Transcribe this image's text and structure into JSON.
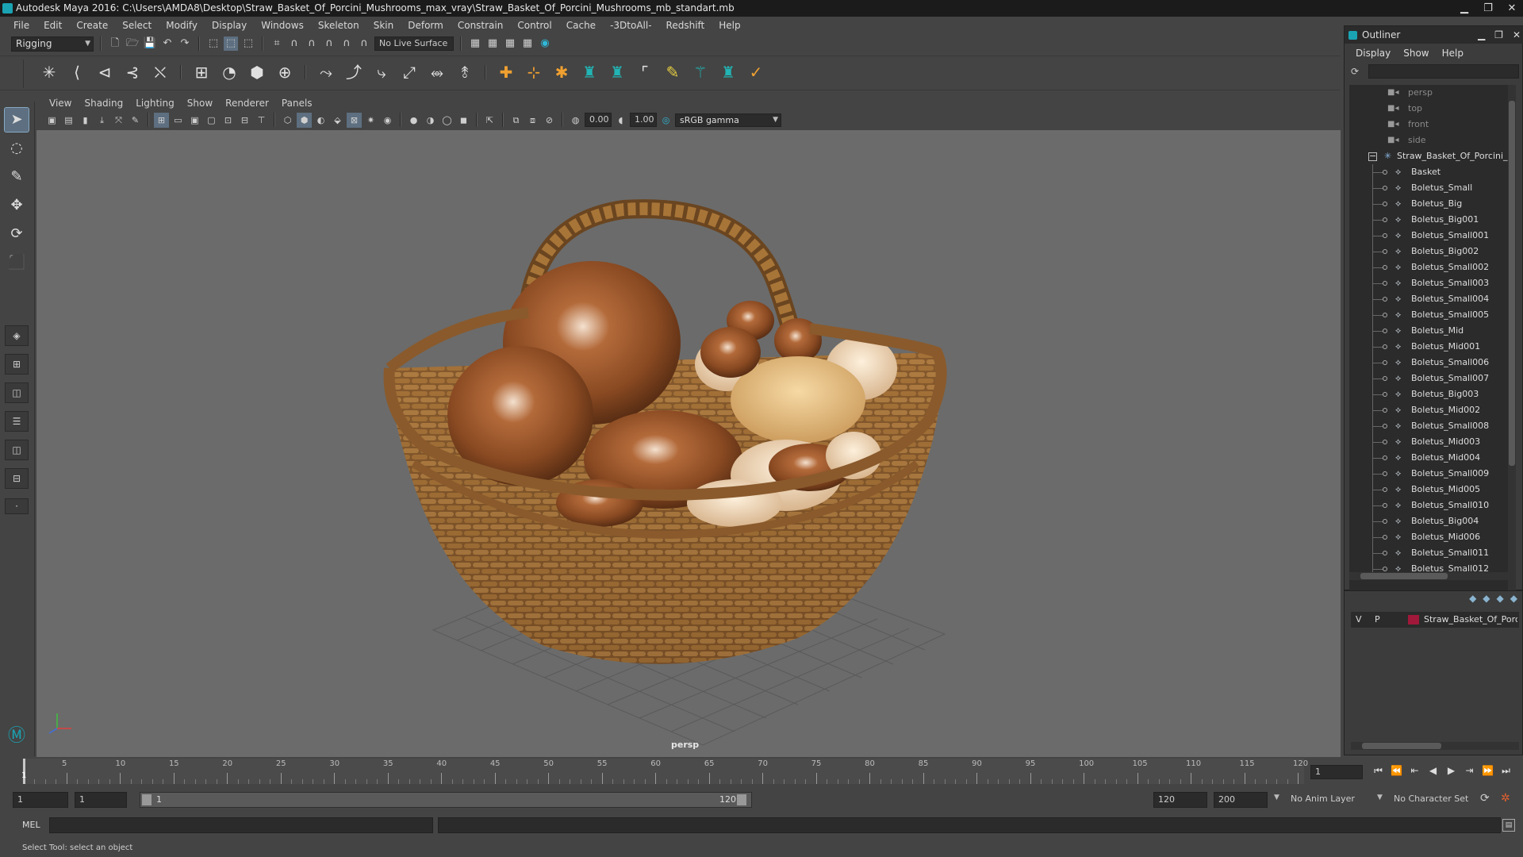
{
  "window": {
    "title": "Autodesk Maya 2016: C:\\Users\\AMDA8\\Desktop\\Straw_Basket_Of_Porcini_Mushrooms_max_vray\\Straw_Basket_Of_Porcini_Mushrooms_mb_standart.mb",
    "minimize": "▁",
    "restore": "❐",
    "close": "✕"
  },
  "menubar": [
    "File",
    "Edit",
    "Create",
    "Select",
    "Modify",
    "Display",
    "Windows",
    "Skeleton",
    "Skin",
    "Deform",
    "Constrain",
    "Control",
    "Cache",
    "-3DtoAll-",
    "Redshift",
    "Help"
  ],
  "statusline": {
    "mode": "Rigging",
    "live_surface": "No Live Surface"
  },
  "panel": {
    "menu": [
      "View",
      "Shading",
      "Lighting",
      "Show",
      "Renderer",
      "Panels"
    ],
    "near": "0.00",
    "far": "1.00",
    "colorspace": "sRGB gamma",
    "camera_label": "persp"
  },
  "outliner": {
    "title": "Outliner",
    "menu": [
      "Display",
      "Show",
      "Help"
    ],
    "cameras": [
      "persp",
      "top",
      "front",
      "side"
    ],
    "group": "Straw_Basket_Of_Porcini_Mushrooms",
    "items": [
      "Basket",
      "Boletus_Small",
      "Boletus_Big",
      "Boletus_Big001",
      "Boletus_Small001",
      "Boletus_Big002",
      "Boletus_Small002",
      "Boletus_Small003",
      "Boletus_Small004",
      "Boletus_Small005",
      "Boletus_Mid",
      "Boletus_Mid001",
      "Boletus_Small006",
      "Boletus_Small007",
      "Boletus_Big003",
      "Boletus_Mid002",
      "Boletus_Small008",
      "Boletus_Mid003",
      "Boletus_Mid004",
      "Boletus_Small009",
      "Boletus_Mid005",
      "Boletus_Small010",
      "Boletus_Big004",
      "Boletus_Mid006",
      "Boletus_Small011",
      "Boletus_Small012"
    ]
  },
  "layers": {
    "visible": "V",
    "playback": "P",
    "name": "Straw_Basket_Of_Porcini_Mushrooms",
    "color": "#a0183a"
  },
  "timeline": {
    "labels": [
      "1",
      "5",
      "10",
      "15",
      "20",
      "25",
      "30",
      "35",
      "40",
      "45",
      "50",
      "55",
      "60",
      "65",
      "70",
      "75",
      "80",
      "85",
      "90",
      "95",
      "100",
      "105",
      "110",
      "115",
      "120"
    ],
    "current_frame": "1"
  },
  "range": {
    "start": "1",
    "playback_start": "1",
    "slider_start": "1",
    "slider_end": "120",
    "playback_end": "120",
    "end": "200",
    "anim_layer": "No Anim Layer",
    "character_set": "No Character Set"
  },
  "command": {
    "lang": "MEL"
  },
  "help": {
    "text": "Select Tool: select an object"
  },
  "icons": {
    "play_controls": [
      "⏮",
      "⏪",
      "⇤",
      "◀",
      "▶",
      "⇥",
      "⏩",
      "⏭"
    ]
  }
}
